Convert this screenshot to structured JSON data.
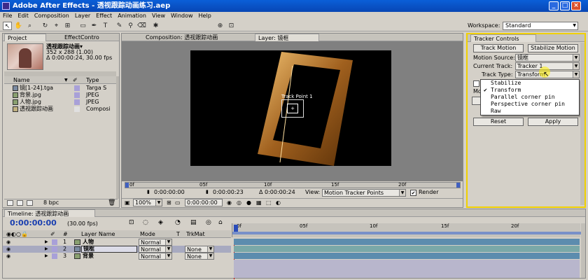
{
  "window": {
    "title": "Adobe After Effects - 透视跟踪动画练习.aep"
  },
  "menu": [
    "File",
    "Edit",
    "Composition",
    "Layer",
    "Effect",
    "Animation",
    "View",
    "Window",
    "Help"
  ],
  "workspace": {
    "label": "Workspace:",
    "value": "Standard"
  },
  "project_panel": {
    "tabs": [
      "Project",
      "EffectContro"
    ],
    "selected_item": {
      "name": "透视跟踪动画▾",
      "info1": "352 x 288 (1.00)",
      "info2": "Δ 0:00:00:24, 30.00 fps"
    },
    "columns": [
      "Name",
      "Type"
    ],
    "items": [
      {
        "name": "镜[1-24].tga",
        "type": "Targa S"
      },
      {
        "name": "背景.jpg",
        "type": "JPEG"
      },
      {
        "name": "人物.jpg",
        "type": "JPEG"
      },
      {
        "name": "透视跟踪动画",
        "type": "Composi"
      }
    ],
    "bpc": "8 bpc"
  },
  "viewer": {
    "comp_tab": "Composition: 透视跟踪动画",
    "layer_tab": "Layer: 镜框",
    "track_point_label": "Track Point 1",
    "ruler_labels": [
      "0f",
      "05f",
      "10f",
      "15f",
      "20f"
    ],
    "time_start": "0:00:00:00",
    "time_end": "0:00:00:23",
    "duration": "Δ 0:00:00:24",
    "view_label": "View:",
    "view_value": "Motion Tracker Points",
    "render_label": "Render",
    "zoom": "100%",
    "current_time": "0:00:00:00"
  },
  "tracker": {
    "tab": "Tracker Controls",
    "track_motion": "Track Motion",
    "stabilize_motion": "Stabilize Motion",
    "motion_source_label": "Motion Source:",
    "motion_source": "镜框",
    "current_track_label": "Current Track:",
    "current_track": "Tracker 1",
    "track_type_label": "Track Type:",
    "track_type": "Transform",
    "options": [
      "Stabilize",
      "Transform",
      "Parallel corner pin",
      "Perspective corner pin",
      "Raw"
    ],
    "checked_option": "Transform",
    "reset": "Reset",
    "apply": "Apply"
  },
  "timeline": {
    "tab": "Timeline: 透视跟踪动画",
    "time": "0:00:00:00",
    "fps": "(30.00 fps)",
    "columns": {
      "num": "#",
      "layer": "Layer Name",
      "mode": "Mode",
      "t": "T",
      "trkmat": "TrkMat"
    },
    "ruler_labels": [
      "0f",
      "05f",
      "10f",
      "15f",
      "20f"
    ],
    "layers": [
      {
        "num": "1",
        "name": "人物",
        "mode": "Normal",
        "trkmat": ""
      },
      {
        "num": "2",
        "name": "镜框",
        "mode": "Normal",
        "trkmat": "None"
      },
      {
        "num": "3",
        "name": "背景",
        "mode": "Normal",
        "trkmat": "None"
      }
    ]
  }
}
